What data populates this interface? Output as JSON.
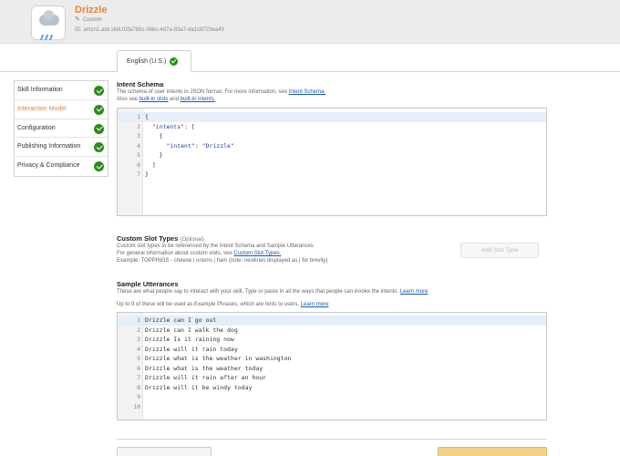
{
  "header": {
    "app_name": "Drizzle",
    "skill_type": "Custom",
    "id_label": "ID:",
    "id_value": "amzn1.ask.skill.02fa7b5c-36bc-4d7a-83a7-4a1c8723ea43"
  },
  "locale_tab": {
    "label": "English (U.S.)"
  },
  "sidebar": {
    "items": [
      {
        "label": "Skill Information",
        "active": false
      },
      {
        "label": "Interaction Model",
        "active": true
      },
      {
        "label": "Configuration",
        "active": false
      },
      {
        "label": "Publishing Information",
        "active": false
      },
      {
        "label": "Privacy & Compliance",
        "active": false
      }
    ]
  },
  "intent_schema": {
    "title": "Intent Schema",
    "desc_1": "The schema of user intents in JSON format. For more information, see ",
    "desc_1_link": "Intent Schema.",
    "desc_2": "Also see ",
    "desc_2_link_a": "built-in slots",
    "desc_2_and": " and ",
    "desc_2_link_b": "built-in intents.",
    "lines": [
      "{",
      "  \"intents\": [",
      "    {",
      "      \"intent\": \"Drizzle\"",
      "    }",
      "  ]",
      "}"
    ]
  },
  "custom_slots": {
    "title": "Custom Slot Types",
    "optional": "(Optional)",
    "desc_1": "Custom slot types to be referenced by the Intent Schema and Sample Utterances",
    "desc_2": "For general information about custom slots, see ",
    "desc_2_link": "Custom Slot Types.",
    "desc_3": "Example: TOPPINGS - cheese | onions | ham (note: newlines displayed as | for brevity)",
    "add_button": "Add Slot Type"
  },
  "sample_utterances": {
    "title": "Sample Utterances",
    "desc_1": "These are what people say to interact with your skill. Type or paste in all the ways that people can invoke the intents. ",
    "desc_1_link": "Learn more",
    "desc_2": "Up to 9 of these will be used as Example Phrases, which are hints to users. ",
    "desc_2_link": "Learn more",
    "lines": [
      "Drizzle can I go out",
      "Drizzle can I walk the dog",
      "Drizzle Is it raining now",
      "Drizzle will it rain today",
      "Drizzle what is the weather in washington",
      "Drizzle what is the weather today",
      "Drizzle will it rain after an hour",
      "Drizzle will it be windy today",
      "",
      ""
    ]
  }
}
